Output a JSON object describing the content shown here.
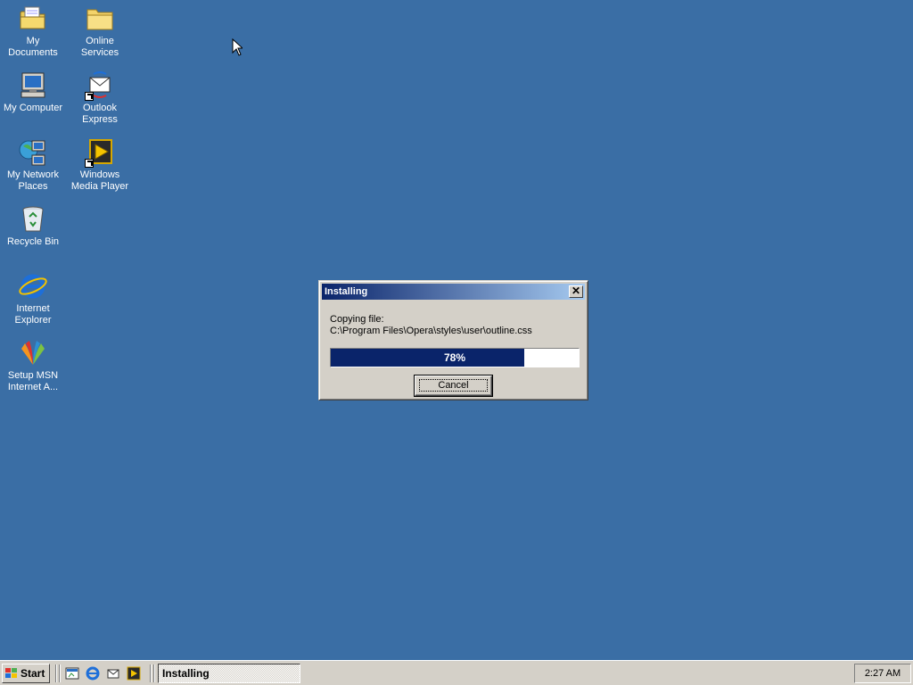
{
  "desktop": {
    "icons": [
      {
        "label": "My Documents",
        "icon": "my-documents-icon"
      },
      {
        "label": "Online Services",
        "icon": "folder-icon"
      },
      {
        "label": "My Computer",
        "icon": "my-computer-icon"
      },
      {
        "label": "Outlook Express",
        "icon": "outlook-express-icon"
      },
      {
        "label": "My Network Places",
        "icon": "network-places-icon"
      },
      {
        "label": "Windows Media Player",
        "icon": "media-player-icon"
      },
      {
        "label": "Recycle Bin",
        "icon": "recycle-bin-icon"
      },
      {
        "label": "Internet Explorer",
        "icon": "internet-explorer-icon"
      },
      {
        "label": "Setup MSN Internet A...",
        "icon": "msn-icon"
      }
    ],
    "background_color": "#3a6ea5"
  },
  "dialog": {
    "title": "Installing",
    "close_label": "✕",
    "message_line1": "Copying file:",
    "message_line2": "C:\\Program Files\\Opera\\styles\\user\\outline.css",
    "progress_value": 0.78,
    "progress_text": "78%",
    "cancel_label": "Cancel"
  },
  "taskbar": {
    "start_label": "Start",
    "quick_launch": [
      "show-desktop-icon",
      "internet-explorer-icon",
      "outlook-express-icon",
      "media-player-icon"
    ],
    "task_label": "Installing",
    "clock": "2:27 AM"
  }
}
